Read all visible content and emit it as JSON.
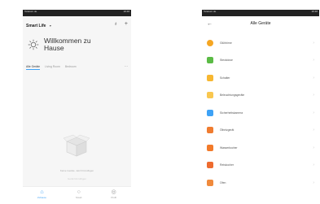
{
  "left": {
    "status": {
      "left": "Telekom.de",
      "right": "18:48"
    },
    "app_title": "Smart Life",
    "dropdown_icon": "chevron-down-icon",
    "header_icons": [
      "scene-icon",
      "add-icon"
    ],
    "welcome": {
      "line1": "Willkommen zu",
      "line2": "Hause"
    },
    "tabs": [
      "Alle Geräte",
      "Living Room",
      "Bedroom",
      "..."
    ],
    "empty_text": "Keine Geräte. Jetzt hinzufügen",
    "add_text": "Gerät hinzufügen",
    "nav": [
      {
        "label": "Zuhause",
        "icon": "home-icon"
      },
      {
        "label": "Smart",
        "icon": "smart-icon"
      },
      {
        "label": "Profil",
        "icon": "profile-icon"
      }
    ]
  },
  "right": {
    "status": {
      "left": "Telekom.de",
      "right": "18:48"
    },
    "back_icon": "back-arrow-icon",
    "title": "Alle Geräte",
    "categories": [
      {
        "label": "Glühbirne",
        "color": "#f5a623",
        "icon": "bulb-icon"
      },
      {
        "label": "Steckdose",
        "color": "#5bbb45",
        "icon": "plug-icon"
      },
      {
        "label": "Schalter",
        "color": "#f7b731",
        "icon": "switch-icon"
      },
      {
        "label": "Beleuchtungsgeräte",
        "color": "#f9c74f",
        "icon": "lamp-icon"
      },
      {
        "label": "Sicherheitskamera",
        "color": "#3ea2f6",
        "icon": "camera-icon"
      },
      {
        "label": "Ölheizgerät",
        "color": "#f07c30",
        "icon": "heater-icon"
      },
      {
        "label": "Wasserkocher",
        "color": "#f27a2a",
        "icon": "kettle-icon"
      },
      {
        "label": "Reiskocher",
        "color": "#ee6b2f",
        "icon": "rice-cooker-icon"
      },
      {
        "label": "Ofen",
        "color": "#f08a3c",
        "icon": "oven-icon"
      }
    ]
  }
}
